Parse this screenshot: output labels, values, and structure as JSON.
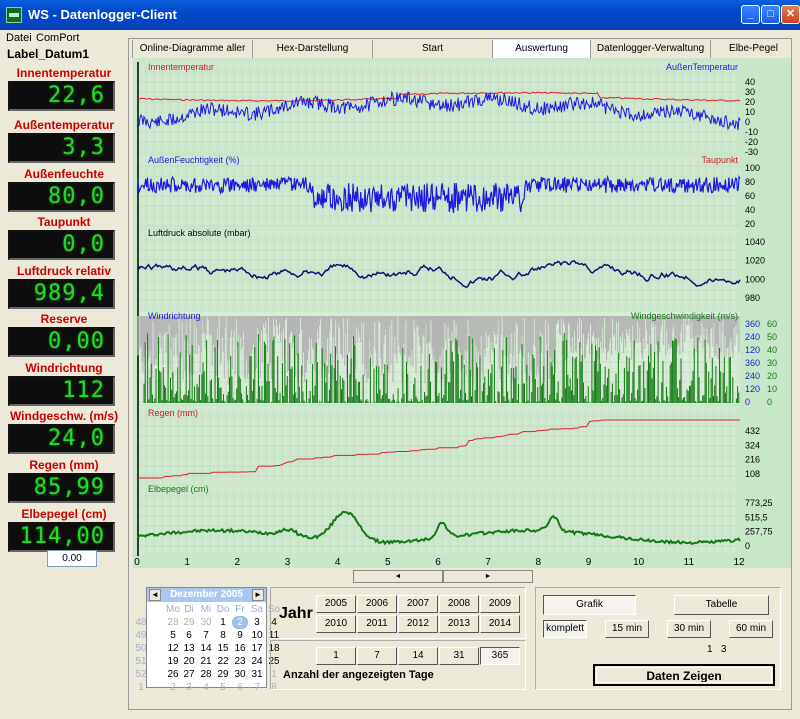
{
  "window": {
    "title": "WS - Datenlogger-Client"
  },
  "menu": [
    "Datei",
    "ComPort"
  ],
  "left": {
    "datum_label": "Label_Datum1",
    "gauges": [
      {
        "label": "Innentemperatur",
        "value": "22,6"
      },
      {
        "label": "Außentemperatur",
        "value": "3,3"
      },
      {
        "label": "Außenfeuchte",
        "value": "80,0"
      },
      {
        "label": "Taupunkt",
        "value": "0,0"
      },
      {
        "label": "Luftdruck relativ",
        "value": "989,4"
      },
      {
        "label": "Reserve",
        "value": "0,00"
      },
      {
        "label": "Windrichtung",
        "value": "112"
      },
      {
        "label": "Windgeschw. (m/s)",
        "value": "24,0"
      },
      {
        "label": "Regen (mm)",
        "value": "85,99"
      },
      {
        "label": "Elbepegel (cm)",
        "value": "114,00"
      }
    ],
    "small_box": "0.00"
  },
  "tabs": [
    "Online-Diagramme aller Werte",
    "Hex-Darstellung",
    "Start",
    "Auswertung",
    "Datenlogger-Verwaltung",
    "Elbe-Pegel einesen"
  ],
  "charts": {
    "p1": {
      "left": "Innentemperatur",
      "right": "AußenTemperatur",
      "ticks": [
        "40",
        "30",
        "20",
        "10",
        "0",
        "-10",
        "-20",
        "-30"
      ]
    },
    "p2": {
      "left": "AußenFeuchtigkeit (%)",
      "right": "Taupunkt",
      "ticks": [
        "100",
        "80",
        "60",
        "40",
        "20"
      ]
    },
    "p3": {
      "left": "Luftdruck absolute  (mbar)",
      "ticks": [
        "1040",
        "1020",
        "1000",
        "980"
      ]
    },
    "p4": {
      "left": "Windrichtung",
      "right": "Windgeschwindigkeit  (m/s)",
      "ticks_a": [
        "360",
        "240",
        "120",
        "360",
        "240",
        "120",
        "0"
      ],
      "ticks_b": [
        "60",
        "50",
        "40",
        "30",
        "20",
        "10",
        "0"
      ]
    },
    "p5": {
      "left": "Regen (mm)",
      "ticks": [
        "432",
        "324",
        "216",
        "108"
      ]
    },
    "p6": {
      "left": "Elbepegel (cm)",
      "ticks": [
        "773,25",
        "515,5",
        "257,75",
        "0"
      ]
    },
    "xticks": [
      "0",
      "1",
      "2",
      "3",
      "4",
      "5",
      "6",
      "7",
      "8",
      "9",
      "10",
      "11",
      "12"
    ]
  },
  "scroll": {
    "left": "◄",
    "right": "►"
  },
  "calendar": {
    "title": "Dezember 2005",
    "prev": "◄",
    "next": "►",
    "days": [
      "Mo",
      "Di",
      "Mi",
      "Do",
      "Fr",
      "Sa",
      "So"
    ],
    "weeks": [
      {
        "wk": "48",
        "d": [
          "28",
          "29",
          "30",
          "1",
          "2",
          "3",
          "4"
        ]
      },
      {
        "wk": "49",
        "d": [
          "5",
          "6",
          "7",
          "8",
          "9",
          "10",
          "11"
        ]
      },
      {
        "wk": "50",
        "d": [
          "12",
          "13",
          "14",
          "15",
          "16",
          "17",
          "18"
        ]
      },
      {
        "wk": "51",
        "d": [
          "19",
          "20",
          "21",
          "22",
          "23",
          "24",
          "25"
        ]
      },
      {
        "wk": "52",
        "d": [
          "26",
          "27",
          "28",
          "29",
          "30",
          "31",
          "1"
        ]
      },
      {
        "wk": "1",
        "d": [
          "2",
          "3",
          "4",
          "5",
          "6",
          "7",
          "8"
        ]
      }
    ]
  },
  "jahr": {
    "label": "Jahr",
    "years": [
      "2005",
      "2006",
      "2007",
      "2008",
      "2009",
      "2010",
      "2011",
      "2012",
      "2013",
      "2014"
    ],
    "days": [
      "1",
      "7",
      "14",
      "31",
      "365"
    ],
    "anzahl_label": "Anzahl der angezeigten Tage"
  },
  "view": {
    "grafik": "Grafik",
    "tabelle": "Tabelle",
    "intervals": [
      "komplett",
      "15 min",
      "30 min",
      "60 min"
    ],
    "counter": "1   3",
    "show_button": "Daten Zeigen"
  }
}
